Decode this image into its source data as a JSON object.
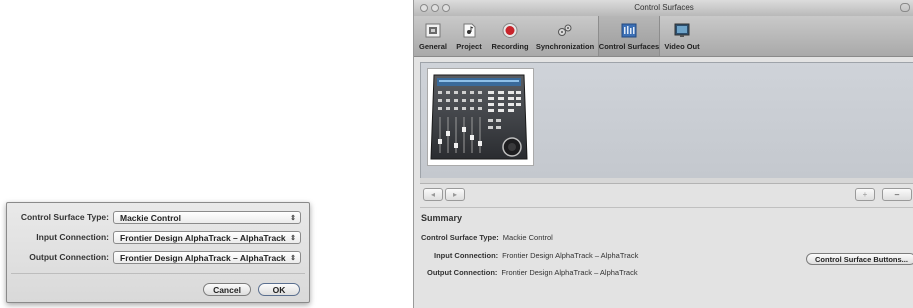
{
  "dialog": {
    "rows": [
      {
        "label": "Control Surface Type:",
        "value": "Mackie Control"
      },
      {
        "label": "Input Connection:",
        "value": "Frontier Design AlphaTrack – AlphaTrack"
      },
      {
        "label": "Output Connection:",
        "value": "Frontier Design AlphaTrack – AlphaTrack"
      }
    ],
    "cancel_label": "Cancel",
    "ok_label": "OK",
    "select_arrow": "⇕"
  },
  "window": {
    "title": "Control Surfaces",
    "toolbar": [
      {
        "label": "General",
        "icon": "general-icon"
      },
      {
        "label": "Project",
        "icon": "project-icon"
      },
      {
        "label": "Recording",
        "icon": "recording-icon"
      },
      {
        "label": "Synchronization",
        "icon": "synchronization-icon"
      },
      {
        "label": "Control Surfaces",
        "icon": "control-surfaces-icon",
        "selected": true
      },
      {
        "label": "Video Out",
        "icon": "video-out-icon"
      }
    ],
    "nav": {
      "prev": "◂",
      "next": "▸",
      "add": "+",
      "remove": "–"
    },
    "summary_title": "Summary",
    "summary": [
      {
        "key": "Control Surface Type:",
        "value": "Mackie Control"
      },
      {
        "key": "Input Connection:",
        "value": "Frontier Design AlphaTrack – AlphaTrack"
      },
      {
        "key": "Output Connection:",
        "value": "Frontier Design AlphaTrack – AlphaTrack"
      }
    ],
    "buttons_label": "Control Surface Buttons..."
  },
  "colors": {
    "selected_toolbar": "#a6a6a6",
    "device_area": "#c9cdd3",
    "record_red": "#c8242b"
  }
}
